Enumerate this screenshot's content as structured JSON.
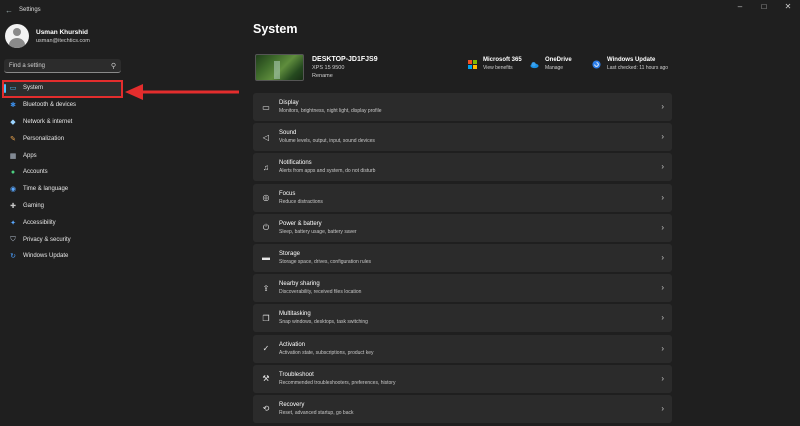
{
  "window": {
    "title": "Settings",
    "back_icon": "back-arrow-icon",
    "controls": [
      "–",
      "□",
      "✕"
    ]
  },
  "profile": {
    "name": "Usman Khurshid",
    "email": "usman@itechtics.com"
  },
  "search": {
    "placeholder": "Find a setting",
    "icon": "search-icon"
  },
  "sidebar": {
    "items": [
      {
        "label": "System",
        "icon": "monitor-icon",
        "active": true
      },
      {
        "label": "Bluetooth & devices",
        "icon": "bluetooth-icon"
      },
      {
        "label": "Network & internet",
        "icon": "wifi-icon"
      },
      {
        "label": "Personalization",
        "icon": "brush-icon"
      },
      {
        "label": "Apps",
        "icon": "apps-icon"
      },
      {
        "label": "Accounts",
        "icon": "person-icon"
      },
      {
        "label": "Time & language",
        "icon": "globe-clock-icon"
      },
      {
        "label": "Gaming",
        "icon": "gamepad-icon"
      },
      {
        "label": "Accessibility",
        "icon": "accessibility-icon"
      },
      {
        "label": "Privacy & security",
        "icon": "shield-icon"
      },
      {
        "label": "Windows Update",
        "icon": "update-icon"
      }
    ]
  },
  "main": {
    "title": "System",
    "device": {
      "name": "DESKTOP-JD1FJS9",
      "model": "XPS 15 9500",
      "rename": "Rename"
    },
    "quick_links": [
      {
        "title": "Microsoft 365",
        "subtitle": "View benefits"
      },
      {
        "title": "OneDrive",
        "subtitle": "Manage"
      },
      {
        "title": "Windows Update",
        "subtitle": "Last checked: 11 hours ago"
      }
    ],
    "cards": [
      {
        "title": "Display",
        "subtitle": "Monitors, brightness, night light, display profile",
        "icon": "display-icon"
      },
      {
        "title": "Sound",
        "subtitle": "Volume levels, output, input, sound devices",
        "icon": "speaker-icon"
      },
      {
        "title": "Notifications",
        "subtitle": "Alerts from apps and system, do not disturb",
        "icon": "bell-icon"
      },
      {
        "title": "Focus",
        "subtitle": "Reduce distractions",
        "icon": "focus-icon"
      },
      {
        "title": "Power & battery",
        "subtitle": "Sleep, battery usage, battery saver",
        "icon": "power-icon"
      },
      {
        "title": "Storage",
        "subtitle": "Storage space, drives, configuration rules",
        "icon": "storage-icon"
      },
      {
        "title": "Nearby sharing",
        "subtitle": "Discoverability, received files location",
        "icon": "share-icon"
      },
      {
        "title": "Multitasking",
        "subtitle": "Snap windows, desktops, task switching",
        "icon": "multitask-icon"
      },
      {
        "title": "Activation",
        "subtitle": "Activation state, subscriptions, product key",
        "icon": "check-circle-icon"
      },
      {
        "title": "Troubleshoot",
        "subtitle": "Recommended troubleshooters, preferences, history",
        "icon": "wrench-icon"
      },
      {
        "title": "Recovery",
        "subtitle": "Reset, advanced startup, go back",
        "icon": "recovery-icon"
      }
    ]
  },
  "colors": {
    "accent": "#4cc2ff",
    "annotation": "#e32d2d",
    "card_bg": "#2b2b2b",
    "window_bg": "#1f1f1f"
  }
}
